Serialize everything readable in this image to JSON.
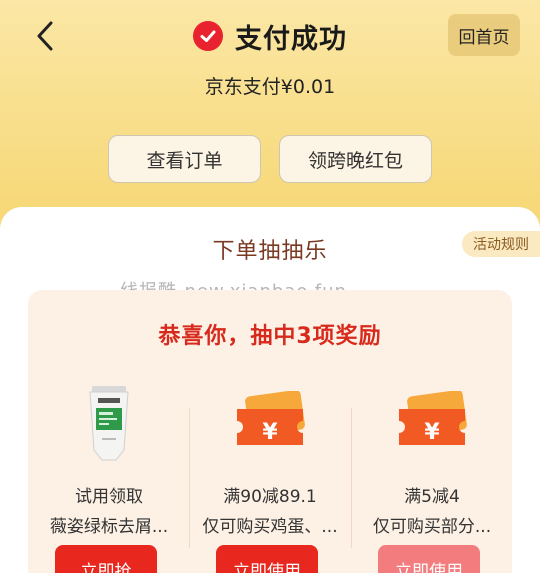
{
  "header": {
    "title": "支付成功",
    "home_label": "回首页"
  },
  "payment": {
    "amount_text": "京东支付¥0.01"
  },
  "actions": {
    "view_order_label": "查看订单",
    "red_packet_label": "领跨晚红包"
  },
  "lottery": {
    "title": "下单抽抽乐",
    "rules_label": "活动规则",
    "watermark": "线报酷-new.xianbao.fun",
    "congrats_text": "恭喜你，抽中3项奖励",
    "prizes": [
      {
        "name": "试用领取",
        "desc": "薇姿绿标去屑...",
        "button": "立即抢",
        "icon": "product-tube-image"
      },
      {
        "name": "满90减89.1",
        "desc": "仅可购买鸡蛋、...",
        "button": "立即使用",
        "icon": "coupon-ticket-icon"
      },
      {
        "name": "满5减4",
        "desc": "仅可购买部分...",
        "button": "立即使用",
        "icon": "coupon-ticket-icon"
      }
    ]
  },
  "colors": {
    "accent_red": "#e8281f",
    "success_red": "#e8222e",
    "faded_red": "#f27c7e"
  }
}
